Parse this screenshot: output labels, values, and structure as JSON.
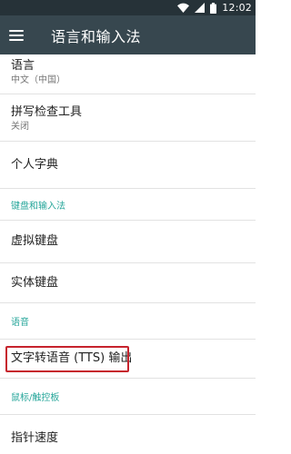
{
  "status_bar": {
    "time": "12:02",
    "icons": [
      "wifi-icon",
      "signal-icon",
      "battery-icon"
    ]
  },
  "app_bar": {
    "title": "语言和输入法",
    "menu_icon": "menu-icon"
  },
  "items": [
    {
      "type": "pref",
      "label": "语言",
      "summary": "中文（中国）"
    },
    {
      "type": "pref",
      "label": "拼写检查工具",
      "summary": "关闭"
    },
    {
      "type": "pref",
      "label": "个人字典"
    },
    {
      "type": "category",
      "label": "键盘和输入法"
    },
    {
      "type": "pref",
      "label": "虚拟键盘"
    },
    {
      "type": "pref",
      "label": "实体键盘"
    },
    {
      "type": "category",
      "label": "语音"
    },
    {
      "type": "pref",
      "label": "文字转语音 (TTS) 输出",
      "highlighted": true
    },
    {
      "type": "category",
      "label": "鼠标/触控板"
    },
    {
      "type": "pref",
      "label": "指针速度"
    }
  ],
  "colors": {
    "status_bar": "#263238",
    "app_bar": "#37474f",
    "category_text": "#26a69a",
    "highlight": "#c6232d"
  }
}
